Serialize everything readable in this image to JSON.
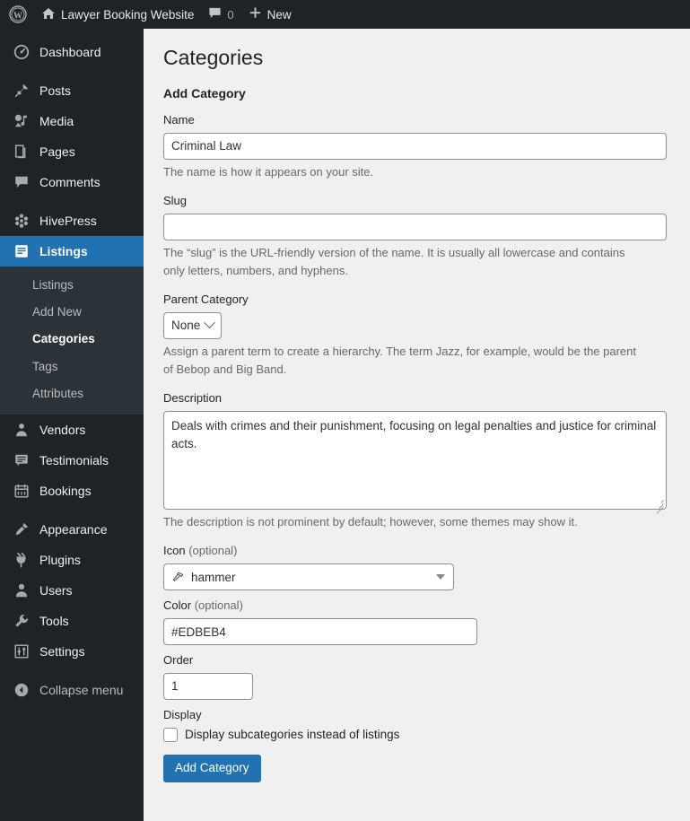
{
  "adminbar": {
    "wp_logo": "wordpress-logo-icon",
    "site_home_icon": "home-icon",
    "site_name": "Lawyer Booking Website",
    "comments_icon": "comment-bubble-icon",
    "comments_count": "0",
    "new_icon": "plus-icon",
    "new_label": "New"
  },
  "sidebar": {
    "items": [
      {
        "label": "Dashboard",
        "icon": "dashboard-gauge-icon",
        "id": "dashboard"
      },
      {
        "label": "Posts",
        "icon": "pin-icon",
        "id": "posts"
      },
      {
        "label": "Media",
        "icon": "media-photo-note-icon",
        "id": "media"
      },
      {
        "label": "Pages",
        "icon": "pages-document-icon",
        "id": "pages"
      },
      {
        "label": "Comments",
        "icon": "comment-bubble-icon",
        "id": "comments"
      },
      {
        "label": "HivePress",
        "icon": "hivepress-honeycomb-icon",
        "id": "hivepress"
      },
      {
        "label": "Listings",
        "icon": "listings-document-icon",
        "id": "listings"
      },
      {
        "label": "Vendors",
        "icon": "user-badge-icon",
        "id": "vendors"
      },
      {
        "label": "Testimonials",
        "icon": "testimonial-quote-icon",
        "id": "testimonials"
      },
      {
        "label": "Bookings",
        "icon": "calendar-icon",
        "id": "bookings"
      },
      {
        "label": "Appearance",
        "icon": "paintbrush-icon",
        "id": "appearance"
      },
      {
        "label": "Plugins",
        "icon": "plug-icon",
        "id": "plugins"
      },
      {
        "label": "Users",
        "icon": "user-icon",
        "id": "users"
      },
      {
        "label": "Tools",
        "icon": "wrench-icon",
        "id": "tools"
      },
      {
        "label": "Settings",
        "icon": "sliders-icon",
        "id": "settings"
      },
      {
        "label": "Collapse menu",
        "icon": "collapse-arrow-icon",
        "id": "collapse"
      }
    ],
    "submenu": [
      {
        "label": "Listings",
        "id": "listings"
      },
      {
        "label": "Add New",
        "id": "add-new"
      },
      {
        "label": "Categories",
        "id": "categories"
      },
      {
        "label": "Tags",
        "id": "tags"
      },
      {
        "label": "Attributes",
        "id": "attributes"
      }
    ],
    "active_item": "Listings",
    "active_submenu": "Categories",
    "accent_color": "#2271b1",
    "background_color": "#1d2327",
    "submenu_background_color": "#2c3338"
  },
  "main": {
    "page_title": "Categories",
    "section_title": "Add Category",
    "fields": {
      "name": {
        "label": "Name",
        "value": "Criminal Law",
        "description": "The name is how it appears on your site."
      },
      "slug": {
        "label": "Slug",
        "value": "",
        "description": "The “slug” is the URL-friendly version of the name. It is usually all lowercase and contains only letters, numbers, and hyphens."
      },
      "parent": {
        "label": "Parent Category",
        "value": "None",
        "description": "Assign a parent term to create a hierarchy. The term Jazz, for example, would be the parent of Bebop and Big Band."
      },
      "description": {
        "label": "Description",
        "value": "Deals with crimes and their punishment, focusing on legal penalties and justice for criminal acts.",
        "description": "The description is not prominent by default; however, some themes may show it."
      },
      "icon": {
        "label": "Icon",
        "optional_suffix": "(optional)",
        "value": "hammer",
        "glyph": "hammer-icon"
      },
      "color": {
        "label": "Color",
        "optional_suffix": "(optional)",
        "value": "#EDBEB4"
      },
      "order": {
        "label": "Order",
        "value": "1"
      },
      "display": {
        "label": "Display",
        "checkbox_label": "Display subcategories instead of listings",
        "checked": false
      }
    },
    "submit_label": "Add Category"
  }
}
